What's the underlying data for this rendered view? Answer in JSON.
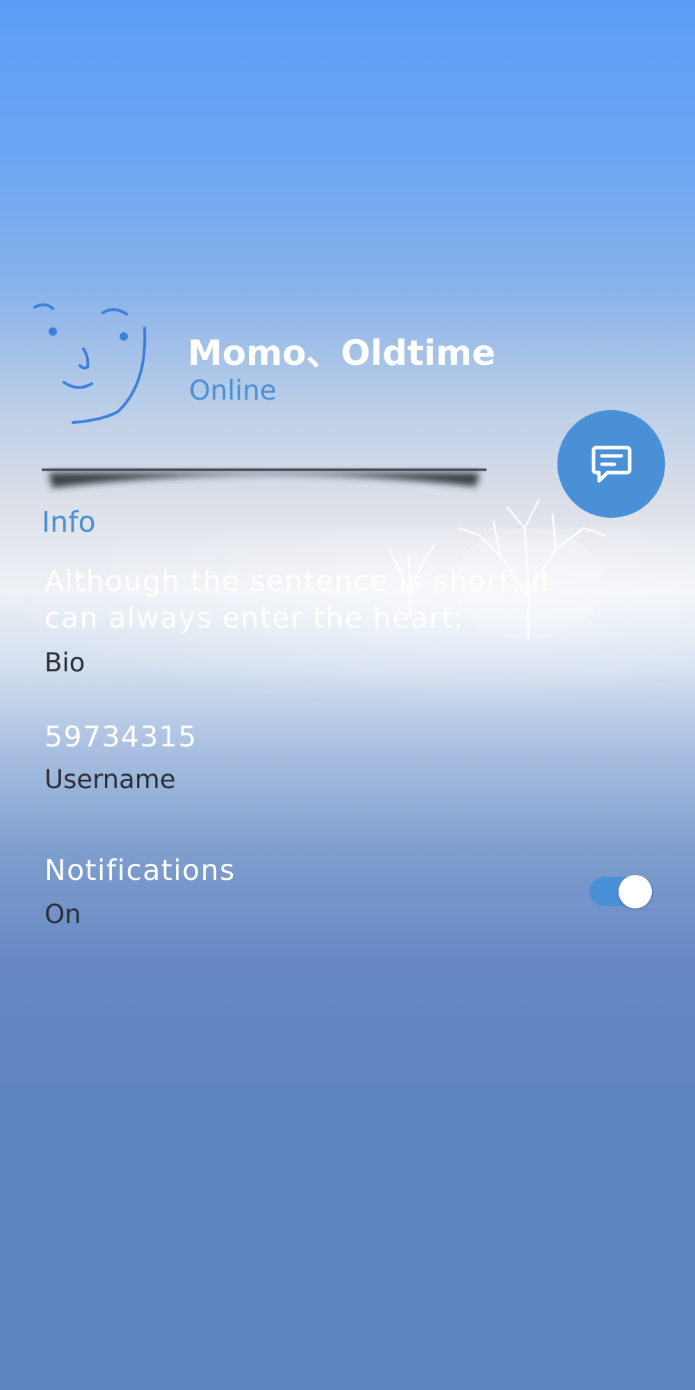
{
  "profile": {
    "name": "Momo、Oldtime",
    "status": "Online"
  },
  "actions": {
    "chat_icon": "chat-bubble-icon"
  },
  "info": {
    "header": "Info",
    "bio": {
      "value": "Although the sentence is short, it can always enter the heart;",
      "label": "Bio"
    },
    "username": {
      "value": "59734315",
      "label": "Username"
    },
    "notifications": {
      "value": "Notifications",
      "label": "On",
      "enabled": true
    }
  },
  "colors": {
    "accent": "#4a90d6",
    "text_primary": "#ffffff",
    "text_secondary": "#2a2f36"
  }
}
